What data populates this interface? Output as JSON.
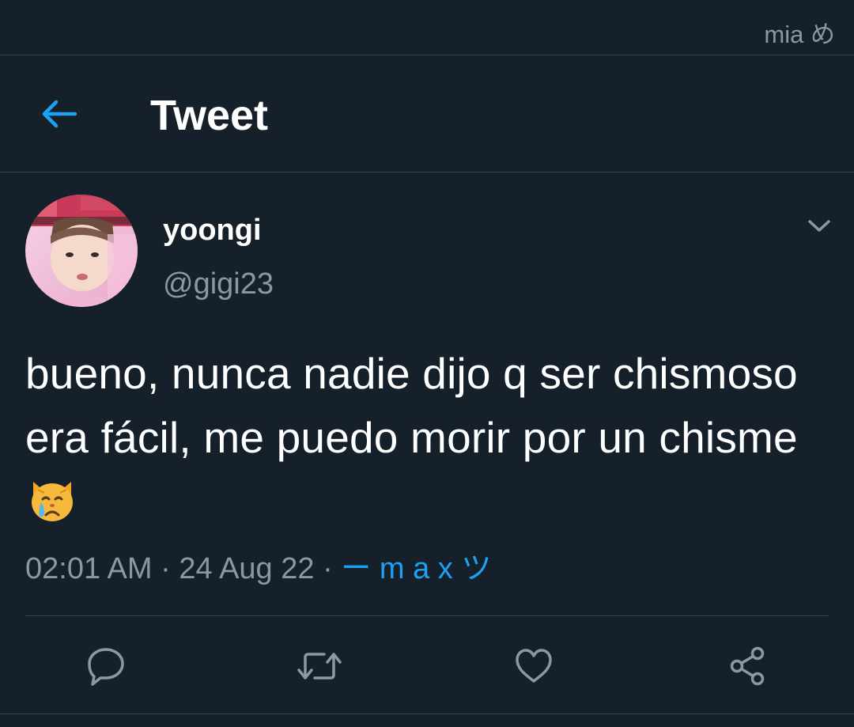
{
  "status_bar": {
    "account": "mia め"
  },
  "header": {
    "title": "Tweet",
    "back_icon": "arrow-left-icon"
  },
  "tweet": {
    "author": {
      "display_name": "yoongi",
      "handle": "@gigi23"
    },
    "text": "bueno, nunca nadie dijo q ser chismoso era fácil, me puedo morir por un chisme",
    "emoji": "crying-cat-face",
    "time": "02:01 AM",
    "date": "24 Aug 22",
    "separator": "·",
    "source": "ー m a x ツ"
  },
  "actions": {
    "icons": [
      "reply-icon",
      "retweet-icon",
      "like-icon",
      "share-icon"
    ]
  },
  "colors": {
    "background": "#15202b",
    "text": "#ffffff",
    "secondary": "#8899a6",
    "accent": "#1da1f2",
    "border": "#38444d"
  }
}
